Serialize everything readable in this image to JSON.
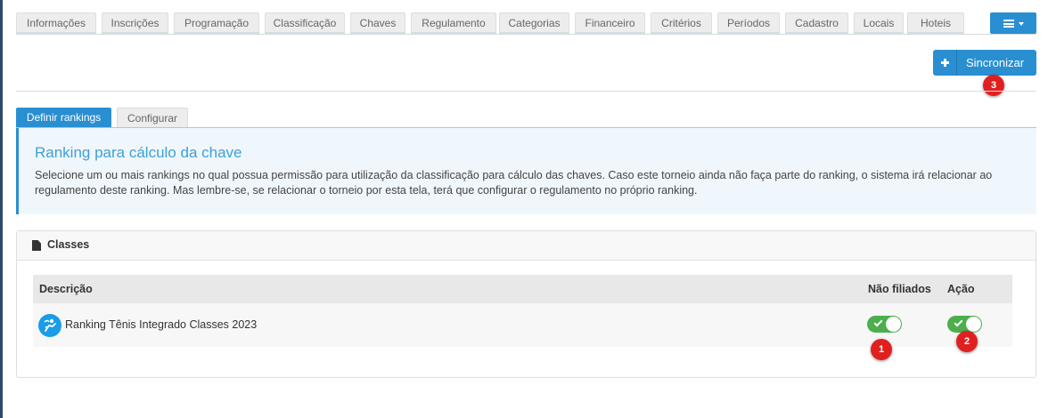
{
  "nav_tabs": [
    "Informações",
    "Inscrições",
    "Programação",
    "Classificação",
    "Chaves",
    "Regulamento",
    "Categorias",
    "Financeiro",
    "Critérios",
    "Períodos",
    "Cadastro",
    "Locais",
    "Hoteis"
  ],
  "menu_icon": "bars-icon",
  "sync_button": {
    "label": "Sincronizar",
    "icon": "plus-icon"
  },
  "sub_tabs": {
    "active": "Definir rankings",
    "inactive": "Configurar"
  },
  "info": {
    "title": "Ranking para cálculo da chave",
    "text": "Selecione um ou mais rankings no qual possua permissão para utilização da classificação para cálculo das chaves. Caso este torneio ainda não faça parte do ranking, o sistema irá relacionar ao regulamento deste ranking. Mas lembre-se, se relacionar o torneio por esta tela, terá que configurar o regulamento no próprio ranking."
  },
  "panel": {
    "title": "Classes",
    "columns": {
      "description": "Descrição",
      "non_affiliated": "Não filiados",
      "action": "Ação"
    },
    "rows": [
      {
        "name": "Ranking Tênis Integrado Classes 2023",
        "non_affiliated_on": true,
        "action_on": true
      }
    ]
  },
  "annotations": [
    "1",
    "2",
    "3"
  ],
  "colors": {
    "primary": "#2a8fd1",
    "toggle_on": "#4cae4c",
    "badge": "#e02020",
    "info_bg": "#f0f7fc"
  }
}
